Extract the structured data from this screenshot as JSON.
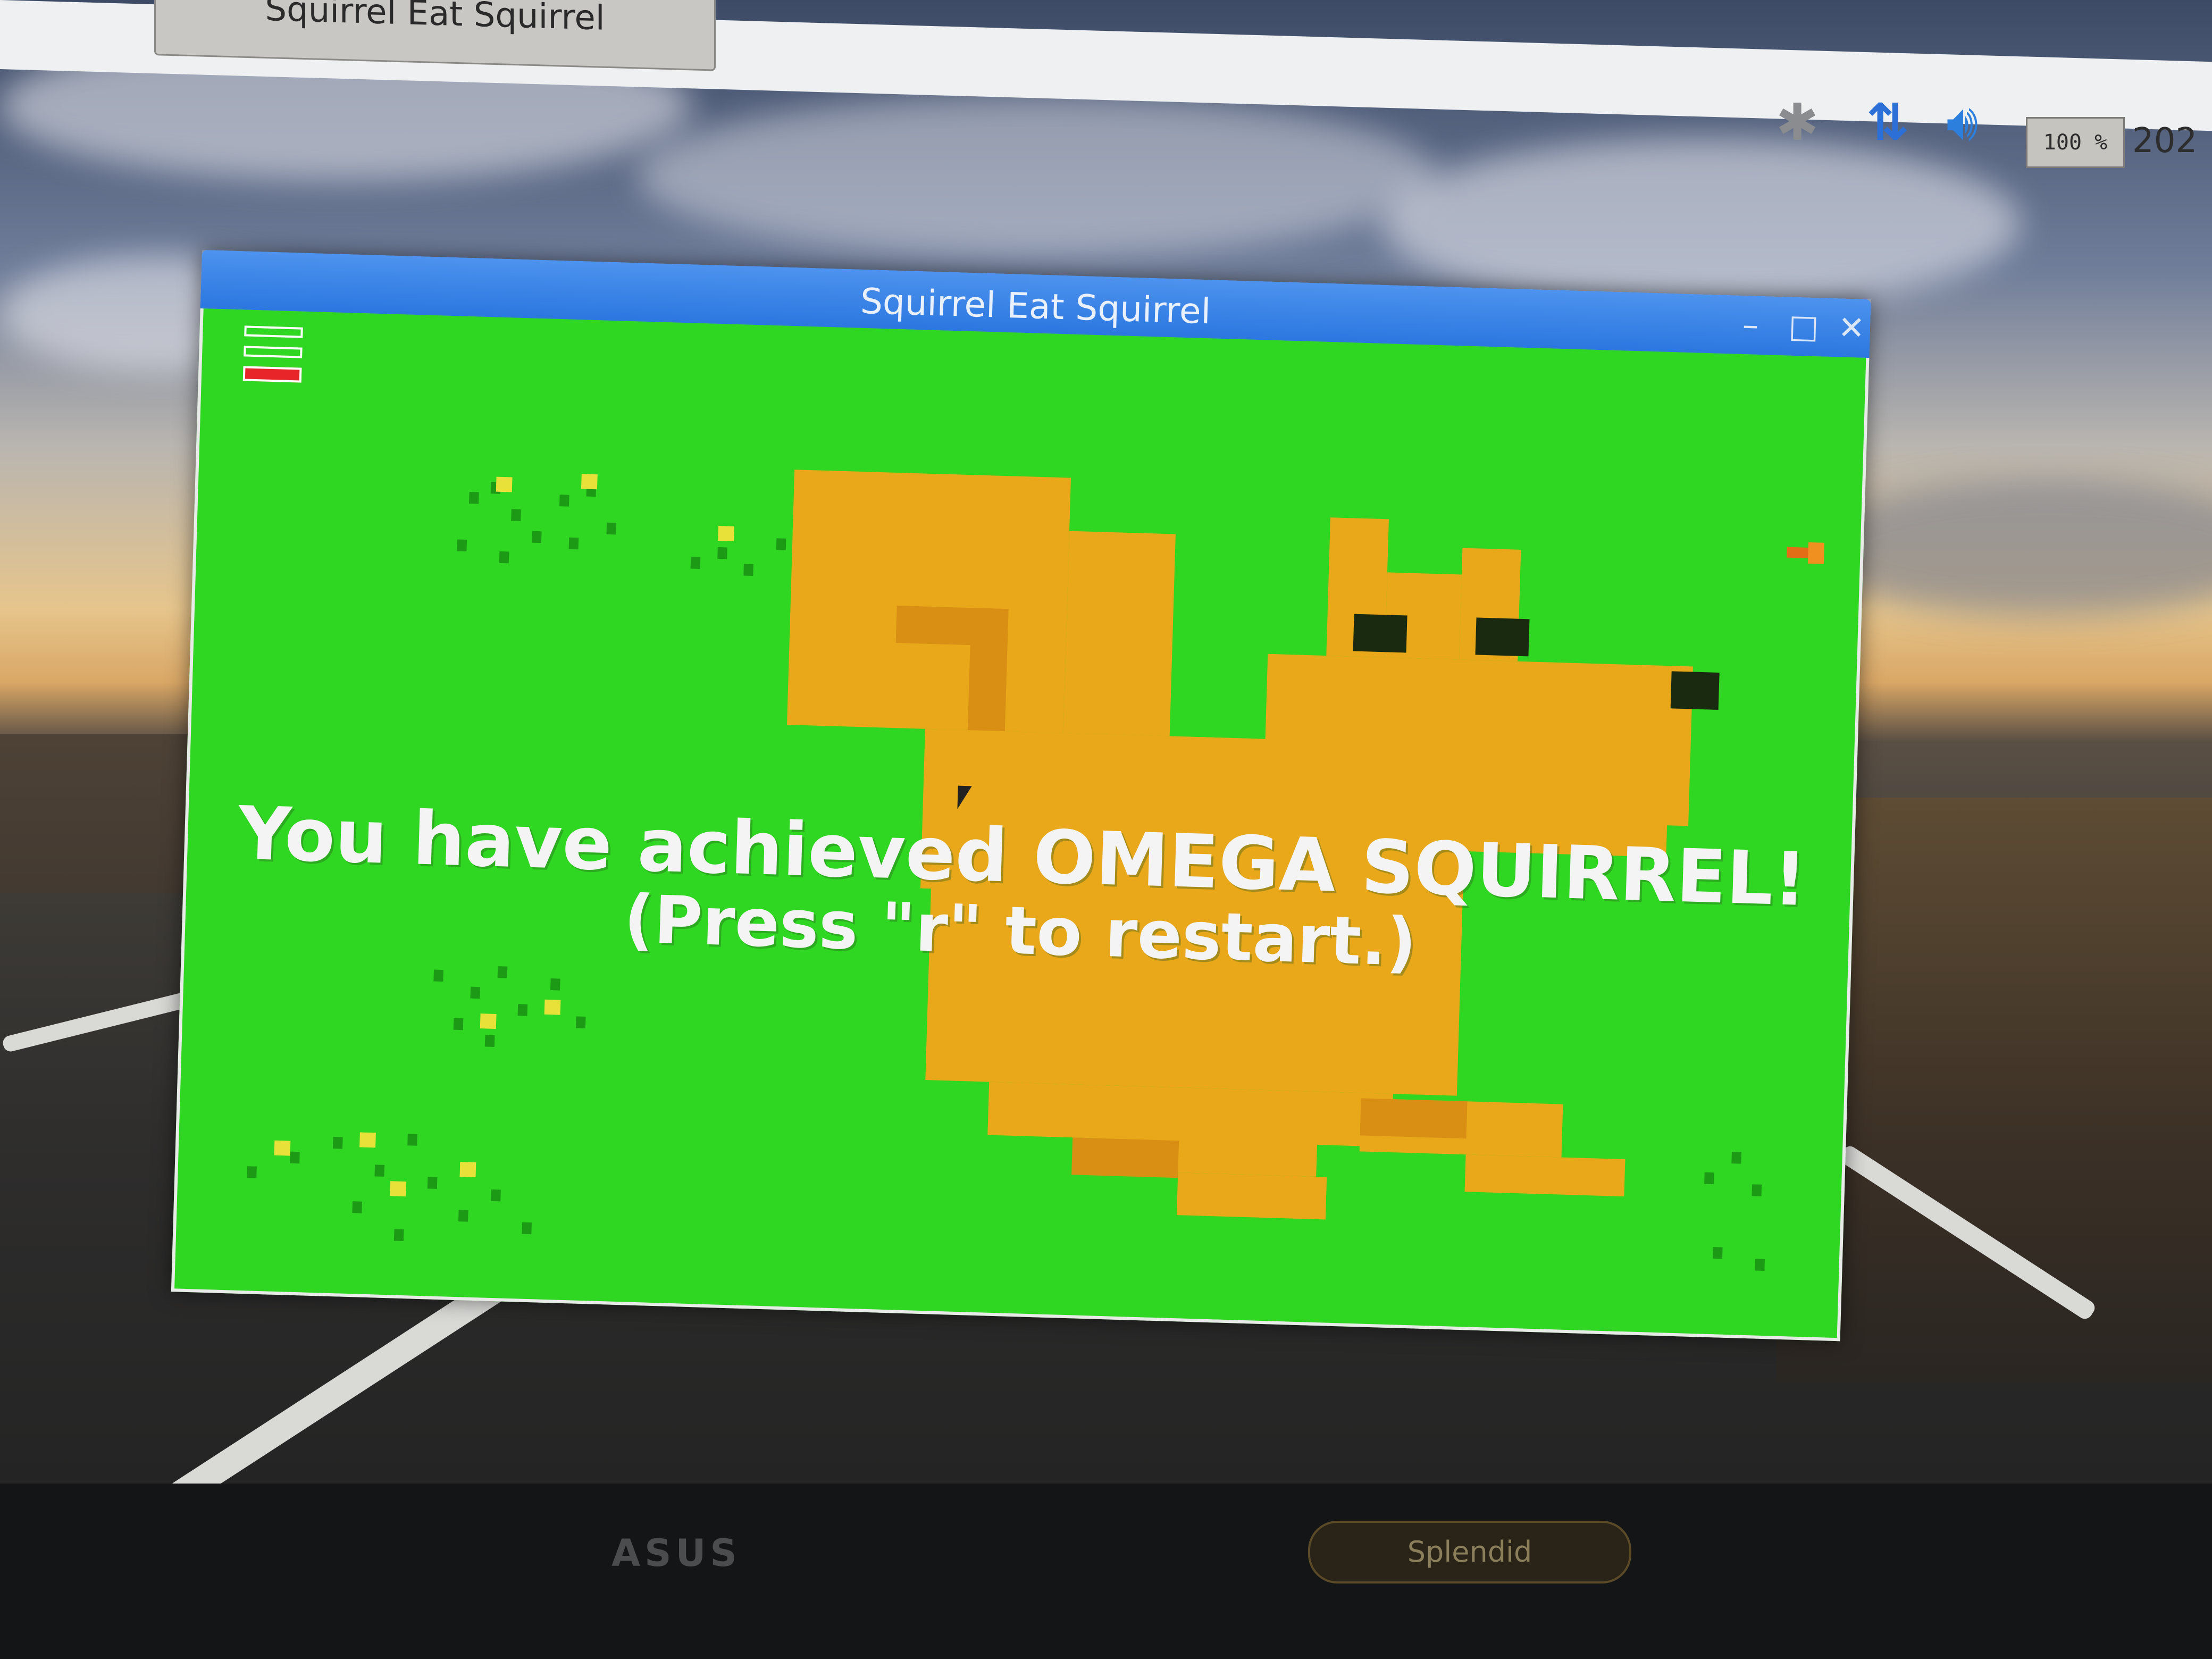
{
  "taskbar": {
    "window_button_label": "Squirrel Eat Squirrel",
    "tray": {
      "icons": [
        "bluetooth-icon",
        "network-icon",
        "volume-icon"
      ],
      "cpu_usage": "100 %",
      "clock": "202"
    }
  },
  "window": {
    "title": "Squirrel Eat Squirrel",
    "controls": {
      "minimize": "–",
      "maximize": "□",
      "close": "✕"
    }
  },
  "game": {
    "message_line1": "You have achieved OMEGA SQUIRREL!",
    "message_line2": "(Press \"r\" to restart.)",
    "health_bar_colors": [
      "#ffffff",
      "#ffffff",
      "#e8262a"
    ],
    "background_color": "#2fd622",
    "squirrel_color": "#e9a71a"
  },
  "monitor": {
    "brand": "ASUS",
    "badge": "Splendid"
  }
}
